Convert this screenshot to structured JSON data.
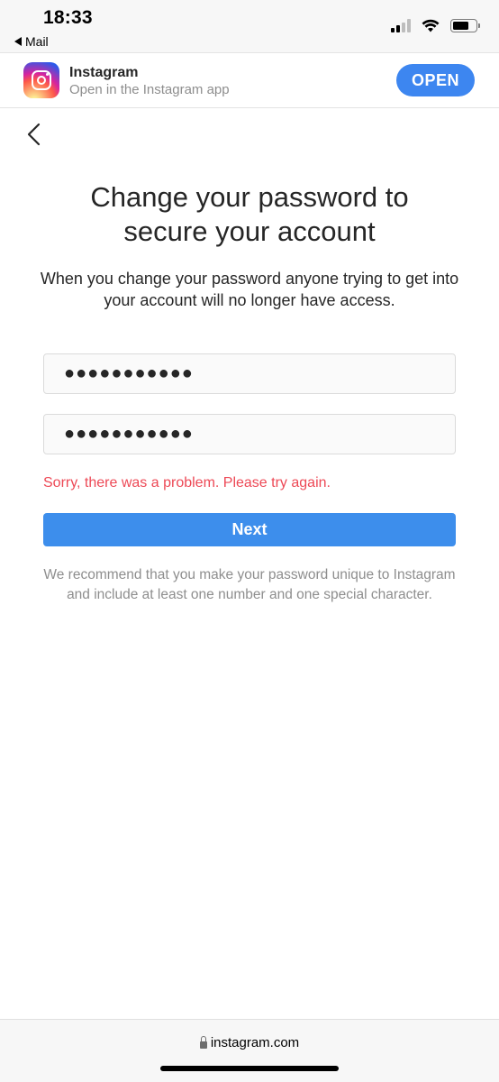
{
  "status_bar": {
    "time": "18:33",
    "back_app": "Mail"
  },
  "app_banner": {
    "title": "Instagram",
    "subtitle": "Open in the Instagram app",
    "open_label": "OPEN",
    "accent_color": "#3d86f0"
  },
  "page": {
    "title_line1": "Change your password to",
    "title_line2": "secure your account",
    "description": "When you change your password anyone trying to get into your account will no longer have access.",
    "new_password_value": "●●●●●●●●●●●",
    "confirm_password_value": "●●●●●●●●●●●",
    "error_message": "Sorry, there was a problem. Please try again.",
    "next_label": "Next",
    "hint": "We recommend that you make your password unique to Instagram and include at least one number and one special character.",
    "error_color": "#ed4956",
    "button_color": "#3d8eec"
  },
  "browser": {
    "url": "instagram.com"
  }
}
